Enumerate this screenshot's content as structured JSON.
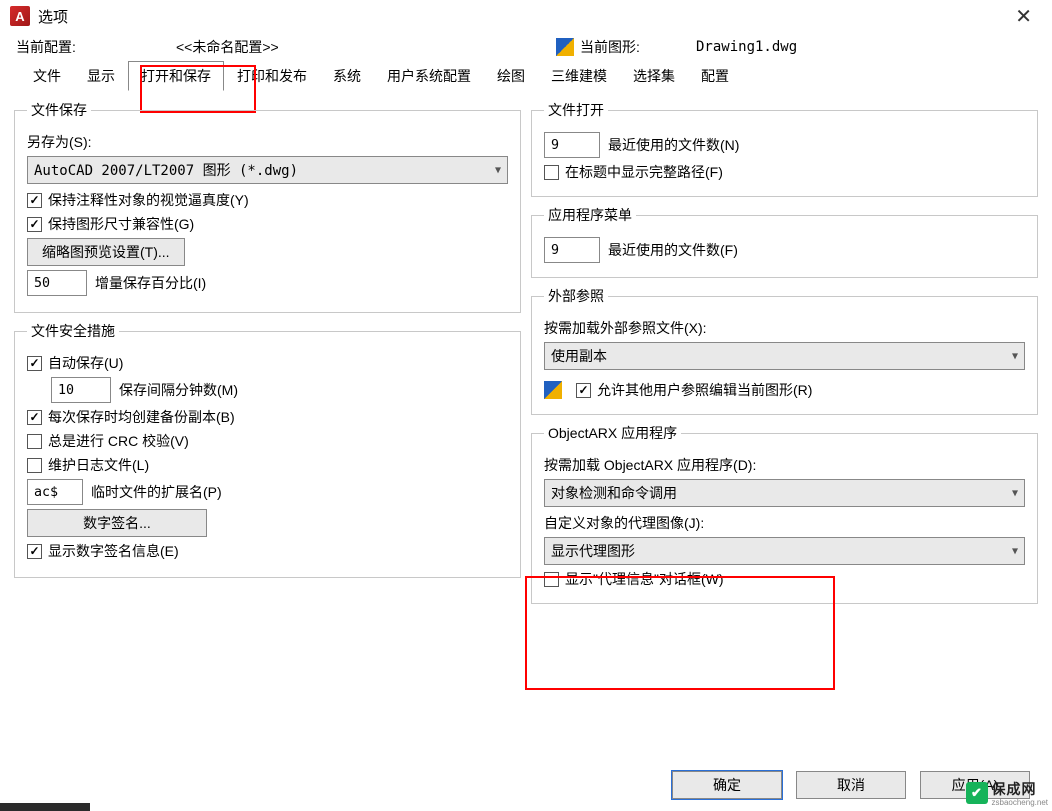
{
  "title": "选项",
  "profile": {
    "currentLabel": "当前配置:",
    "currentValue": "<<未命名配置>>",
    "drawingLabel": "当前图形:",
    "drawingValue": "Drawing1.dwg"
  },
  "tabs": {
    "t1": "文件",
    "t2": "显示",
    "t3": "打开和保存",
    "t4": "打印和发布",
    "t5": "系统",
    "t6": "用户系统配置",
    "t7": "绘图",
    "t8": "三维建模",
    "t9": "选择集",
    "t10": "配置"
  },
  "fileSave": {
    "legend": "文件保存",
    "saveAsLabel": "另存为(S):",
    "saveAsFormat": "AutoCAD 2007/LT2007 图形 (*.dwg)",
    "annotFidelity": "保持注释性对象的视觉逼真度(Y)",
    "drawingSizeCompat": "保持图形尺寸兼容性(G)",
    "thumbnailBtn": "缩略图预览设置(T)...",
    "incrSavePct": "50",
    "incrSaveLabel": "增量保存百分比(I)"
  },
  "fileSafety": {
    "legend": "文件安全措施",
    "autoSave": "自动保存(U)",
    "autoSaveMin": "10",
    "autoSaveMinLabel": "保存间隔分钟数(M)",
    "backupEachSave": "每次保存时均创建备份副本(B)",
    "crcCheck": "总是进行 CRC 校验(V)",
    "logFile": "维护日志文件(L)",
    "tempExt": "ac$",
    "tempExtLabel": "临时文件的扩展名(P)",
    "digSigBtn": "数字签名...",
    "showDigSig": "显示数字签名信息(E)"
  },
  "fileOpen": {
    "legend": "文件打开",
    "recentCount": "9",
    "recentLabel": "最近使用的文件数(N)",
    "fullPathTitle": "在标题中显示完整路径(F)"
  },
  "appMenu": {
    "legend": "应用程序菜单",
    "recentCount": "9",
    "recentLabel": "最近使用的文件数(F)"
  },
  "xref": {
    "legend": "外部参照",
    "loadLabel": "按需加载外部参照文件(X):",
    "loadMode": "使用副本",
    "allowOthersEdit": "允许其他用户参照编辑当前图形(R)"
  },
  "arx": {
    "legend": "ObjectARX 应用程序",
    "loadLabel": "按需加载 ObjectARX 应用程序(D):",
    "loadMode": "对象检测和命令调用",
    "proxyImgLabel": "自定义对象的代理图像(J):",
    "proxyImgMode": "显示代理图形",
    "showProxyDialog": "显示\"代理信息\"对话框(W)"
  },
  "buttons": {
    "ok": "确定",
    "cancel": "取消",
    "apply": "应用(A)"
  },
  "watermark": {
    "brand": "保成网",
    "sub": "zsbaocheng.net"
  }
}
